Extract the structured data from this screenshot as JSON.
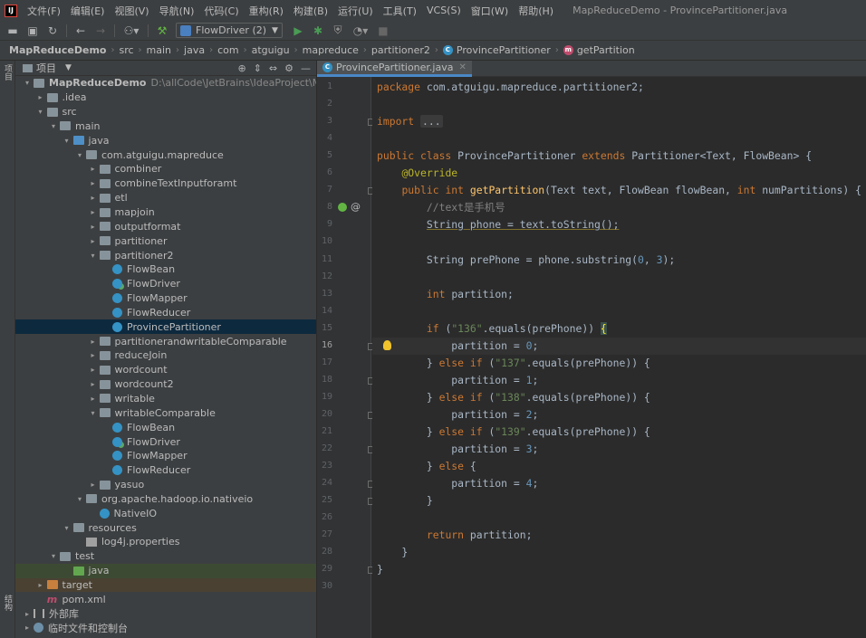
{
  "menubar": {
    "items": [
      "文件(F)",
      "编辑(E)",
      "视图(V)",
      "导航(N)",
      "代码(C)",
      "重构(R)",
      "构建(B)",
      "运行(U)",
      "工具(T)",
      "VCS(S)",
      "窗口(W)",
      "帮助(H)"
    ],
    "window_title": "MapReduceDemo - ProvincePartitioner.java"
  },
  "toolbar": {
    "run_config": "FlowDriver (2)"
  },
  "breadcrumb": [
    "MapReduceDemo",
    "src",
    "main",
    "java",
    "com",
    "atguigu",
    "mapreduce",
    "partitioner2",
    "ProvincePartitioner",
    "getPartition"
  ],
  "left_stripe": {
    "project_tab": "项目",
    "structure_tab": "结构"
  },
  "project_panel": {
    "title": "项目",
    "tree": [
      {
        "label": "MapReduceDemo",
        "path": "D:\\allCode\\JetBrains\\IdeaProject\\MapReduceDemo",
        "depth": 0,
        "arrow": "▾",
        "icon": "folder",
        "bold": true
      },
      {
        "label": ".idea",
        "depth": 1,
        "arrow": "▸",
        "icon": "folder"
      },
      {
        "label": "src",
        "depth": 1,
        "arrow": "▾",
        "icon": "folder"
      },
      {
        "label": "main",
        "depth": 2,
        "arrow": "▾",
        "icon": "folder"
      },
      {
        "label": "java",
        "depth": 3,
        "arrow": "▾",
        "icon": "folder-blue"
      },
      {
        "label": "com.atguigu.mapreduce",
        "depth": 4,
        "arrow": "▾",
        "icon": "pkg"
      },
      {
        "label": "combiner",
        "depth": 5,
        "arrow": "▸",
        "icon": "pkg"
      },
      {
        "label": "combineTextInputforamt",
        "depth": 5,
        "arrow": "▸",
        "icon": "pkg"
      },
      {
        "label": "etl",
        "depth": 5,
        "arrow": "▸",
        "icon": "pkg"
      },
      {
        "label": "mapjoin",
        "depth": 5,
        "arrow": "▸",
        "icon": "pkg"
      },
      {
        "label": "outputformat",
        "depth": 5,
        "arrow": "▸",
        "icon": "pkg"
      },
      {
        "label": "partitioner",
        "depth": 5,
        "arrow": "▸",
        "icon": "pkg"
      },
      {
        "label": "partitioner2",
        "depth": 5,
        "arrow": "▾",
        "icon": "pkg"
      },
      {
        "label": "FlowBean",
        "depth": 6,
        "arrow": "",
        "icon": "cls"
      },
      {
        "label": "FlowDriver",
        "depth": 6,
        "arrow": "",
        "icon": "cls-run"
      },
      {
        "label": "FlowMapper",
        "depth": 6,
        "arrow": "",
        "icon": "cls"
      },
      {
        "label": "FlowReducer",
        "depth": 6,
        "arrow": "",
        "icon": "cls"
      },
      {
        "label": "ProvincePartitioner",
        "depth": 6,
        "arrow": "",
        "icon": "cls",
        "selected": true
      },
      {
        "label": "partitionerandwritableComparable",
        "depth": 5,
        "arrow": "▸",
        "icon": "pkg"
      },
      {
        "label": "reduceJoin",
        "depth": 5,
        "arrow": "▸",
        "icon": "pkg"
      },
      {
        "label": "wordcount",
        "depth": 5,
        "arrow": "▸",
        "icon": "pkg"
      },
      {
        "label": "wordcount2",
        "depth": 5,
        "arrow": "▸",
        "icon": "pkg"
      },
      {
        "label": "writable",
        "depth": 5,
        "arrow": "▸",
        "icon": "pkg"
      },
      {
        "label": "writableComparable",
        "depth": 5,
        "arrow": "▾",
        "icon": "pkg"
      },
      {
        "label": "FlowBean",
        "depth": 6,
        "arrow": "",
        "icon": "cls"
      },
      {
        "label": "FlowDriver",
        "depth": 6,
        "arrow": "",
        "icon": "cls-run"
      },
      {
        "label": "FlowMapper",
        "depth": 6,
        "arrow": "",
        "icon": "cls"
      },
      {
        "label": "FlowReducer",
        "depth": 6,
        "arrow": "",
        "icon": "cls"
      },
      {
        "label": "yasuo",
        "depth": 5,
        "arrow": "▸",
        "icon": "pkg"
      },
      {
        "label": "org.apache.hadoop.io.nativeio",
        "depth": 4,
        "arrow": "▾",
        "icon": "pkg"
      },
      {
        "label": "NativeIO",
        "depth": 5,
        "arrow": "",
        "icon": "cls"
      },
      {
        "label": "resources",
        "depth": 3,
        "arrow": "▾",
        "icon": "folder"
      },
      {
        "label": "log4j.properties",
        "depth": 4,
        "arrow": "",
        "icon": "props"
      },
      {
        "label": "test",
        "depth": 2,
        "arrow": "▾",
        "icon": "folder"
      },
      {
        "label": "java",
        "depth": 3,
        "arrow": "",
        "icon": "folder-green",
        "highlight": "green"
      },
      {
        "label": "target",
        "depth": 1,
        "arrow": "▸",
        "icon": "folder-orange",
        "highlight": "orange"
      },
      {
        "label": "pom.xml",
        "depth": 1,
        "arrow": "",
        "icon": "mvn"
      },
      {
        "label": "外部库",
        "depth": 0,
        "arrow": "▸",
        "icon": "lib"
      },
      {
        "label": "临时文件和控制台",
        "depth": 0,
        "arrow": "▸",
        "icon": "scratch"
      }
    ]
  },
  "editor": {
    "tab_label": "ProvincePartitioner.java",
    "current_line": 16,
    "lines": [
      [
        [
          "kw",
          "package "
        ],
        [
          "plain",
          "com.atguigu.mapreduce.partitioner2;"
        ]
      ],
      [],
      [
        [
          "kw",
          "import "
        ],
        [
          "fold",
          "..."
        ]
      ],
      [],
      [
        [
          "kw",
          "public class "
        ],
        [
          "plain",
          "ProvincePartitioner "
        ],
        [
          "kw",
          "extends "
        ],
        [
          "plain",
          "Partitioner<Text, FlowBean> {"
        ]
      ],
      [
        [
          "plain",
          "    "
        ],
        [
          "ann",
          "@Override"
        ]
      ],
      [
        [
          "plain",
          "    "
        ],
        [
          "kw",
          "public int "
        ],
        [
          "fn",
          "getPartition"
        ],
        [
          "plain",
          "(Text text, FlowBean flowBean, "
        ],
        [
          "kw",
          "int "
        ],
        [
          "plain",
          "numPartitions) {"
        ]
      ],
      [
        [
          "plain",
          "        "
        ],
        [
          "cmt",
          "//text是手机号"
        ]
      ],
      [
        [
          "plain",
          "        "
        ],
        [
          "hl",
          "String phone = text.toString();"
        ]
      ],
      [],
      [
        [
          "plain",
          "        String prePhone = phone.substring("
        ],
        [
          "num",
          "0"
        ],
        [
          "plain",
          ", "
        ],
        [
          "num",
          "3"
        ],
        [
          "plain",
          ");"
        ]
      ],
      [],
      [
        [
          "plain",
          "        "
        ],
        [
          "kw",
          "int "
        ],
        [
          "plain",
          "partition;"
        ]
      ],
      [],
      [
        [
          "plain",
          "        "
        ],
        [
          "kw",
          "if "
        ],
        [
          "plain",
          "("
        ],
        [
          "str",
          "\"136\""
        ],
        [
          "plain",
          ".equals(prePhone)) "
        ],
        [
          "brace",
          "{"
        ]
      ],
      [
        [
          "plain",
          "            partition = "
        ],
        [
          "num",
          "0"
        ],
        [
          "plain",
          ";"
        ]
      ],
      [
        [
          "plain",
          "        } "
        ],
        [
          "kw",
          "else if "
        ],
        [
          "plain",
          "("
        ],
        [
          "str",
          "\"137\""
        ],
        [
          "plain",
          ".equals(prePhone)) {"
        ]
      ],
      [
        [
          "plain",
          "            partition = "
        ],
        [
          "num",
          "1"
        ],
        [
          "plain",
          ";"
        ]
      ],
      [
        [
          "plain",
          "        } "
        ],
        [
          "kw",
          "else if "
        ],
        [
          "plain",
          "("
        ],
        [
          "str",
          "\"138\""
        ],
        [
          "plain",
          ".equals(prePhone)) {"
        ]
      ],
      [
        [
          "plain",
          "            partition = "
        ],
        [
          "num",
          "2"
        ],
        [
          "plain",
          ";"
        ]
      ],
      [
        [
          "plain",
          "        } "
        ],
        [
          "kw",
          "else if "
        ],
        [
          "plain",
          "("
        ],
        [
          "str",
          "\"139\""
        ],
        [
          "plain",
          ".equals(prePhone)) {"
        ]
      ],
      [
        [
          "plain",
          "            partition = "
        ],
        [
          "num",
          "3"
        ],
        [
          "plain",
          ";"
        ]
      ],
      [
        [
          "plain",
          "        } "
        ],
        [
          "kw",
          "else "
        ],
        [
          "plain",
          "{"
        ]
      ],
      [
        [
          "plain",
          "            partition = "
        ],
        [
          "num",
          "4"
        ],
        [
          "plain",
          ";"
        ]
      ],
      [
        [
          "plain",
          "        }"
        ]
      ],
      [],
      [
        [
          "plain",
          "        "
        ],
        [
          "kw",
          "return "
        ],
        [
          "plain",
          "partition;"
        ]
      ],
      [
        [
          "plain",
          "    }"
        ]
      ],
      [
        [
          "plain",
          "}"
        ]
      ],
      []
    ]
  },
  "colors": {
    "keyword": "#cc7832",
    "annotation": "#bbb529",
    "method": "#ffc66d",
    "string": "#6a8759",
    "number": "#6897bb",
    "comment": "#808080",
    "selection": "#0d293e"
  }
}
